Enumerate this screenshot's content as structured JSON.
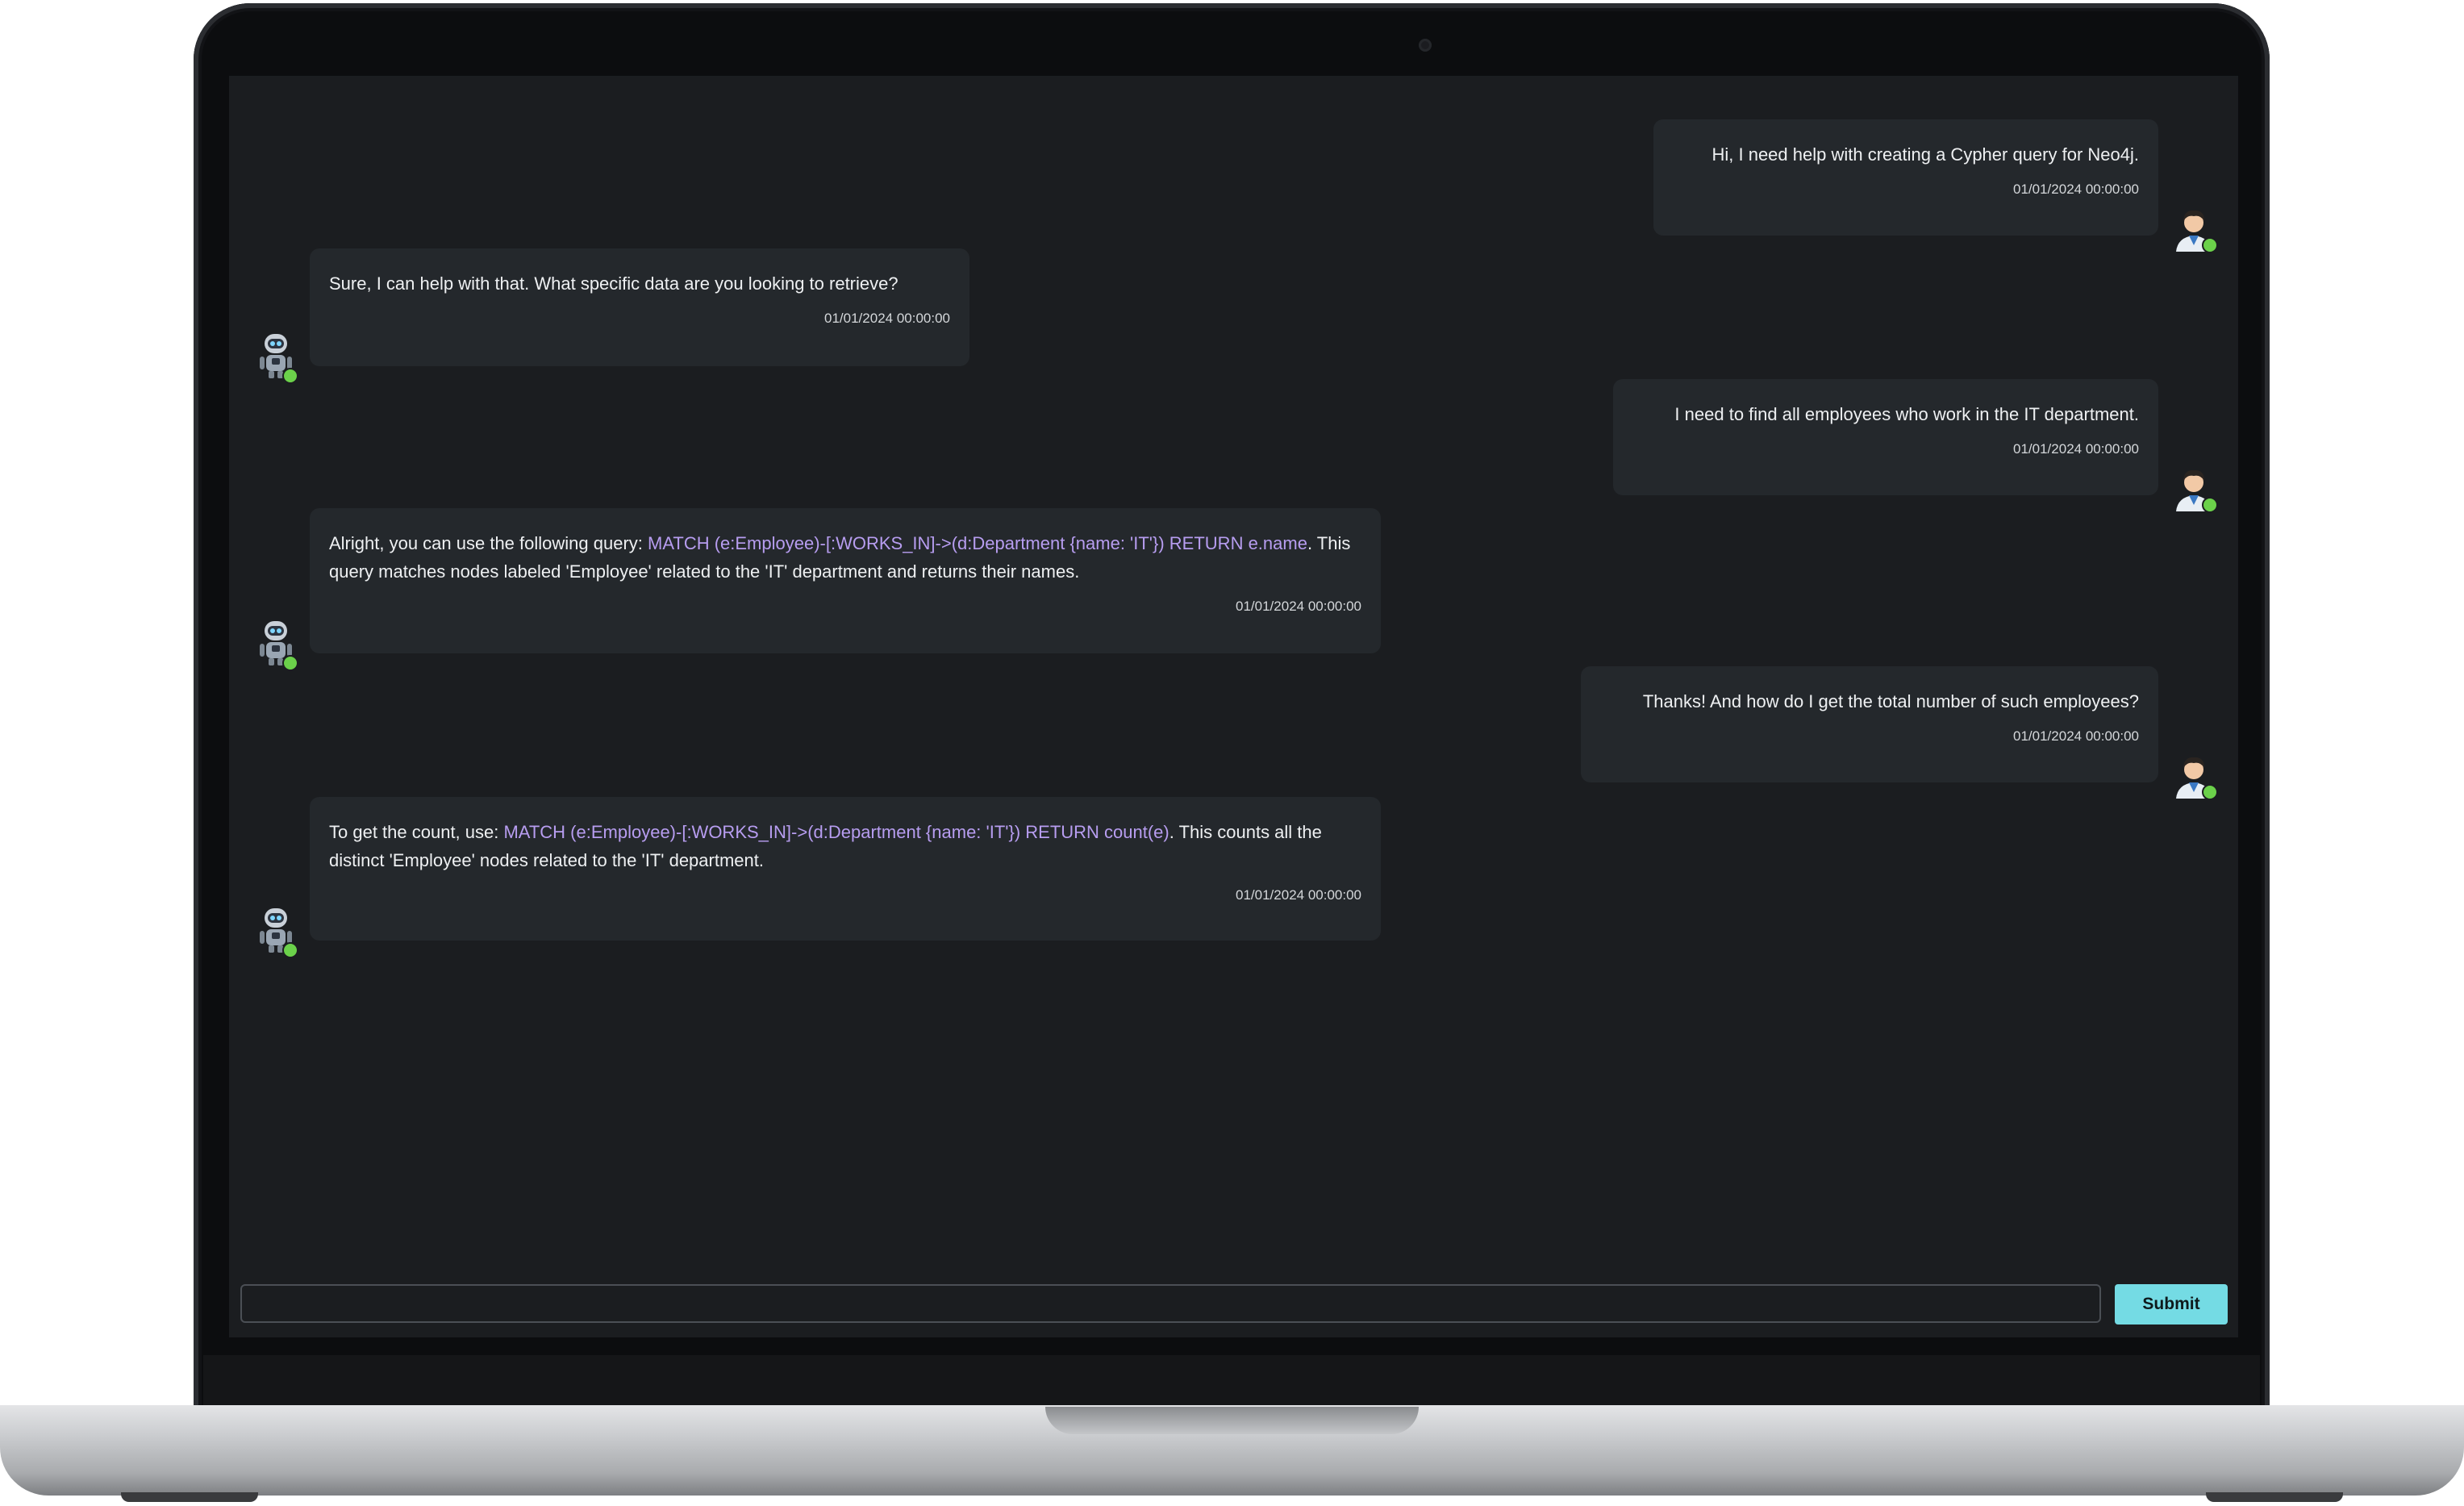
{
  "chat": {
    "messages": [
      {
        "role": "user",
        "text": "Hi, I need help with creating a Cypher query for Neo4j.",
        "time": "01/01/2024 00:00:00"
      },
      {
        "role": "bot",
        "text": "Sure, I can help with that. What specific data are you looking to retrieve?",
        "time": "01/01/2024 00:00:00"
      },
      {
        "role": "user",
        "text": "I need to find all employees who work in the IT department.",
        "time": "01/01/2024 00:00:00"
      },
      {
        "role": "bot",
        "pre": "Alright, you can use the following query: ",
        "code": "MATCH (e:Employee)-[:WORKS_IN]->(d:Department {name: 'IT'}) RETURN e.name",
        "post": ". This query matches nodes labeled 'Employee' related to the 'IT' department and returns their names.",
        "time": "01/01/2024 00:00:00"
      },
      {
        "role": "user",
        "text": "Thanks! And how do I get the total number of such employees?",
        "time": "01/01/2024 00:00:00"
      },
      {
        "role": "bot",
        "pre": "To get the count, use: ",
        "code": "MATCH (e:Employee)-[:WORKS_IN]->(d:Department {name: 'IT'}) RETURN count(e)",
        "post": ". This counts all the distinct 'Employee' nodes related to the 'IT' department.",
        "time": "01/01/2024 00:00:00"
      }
    ]
  },
  "composer": {
    "input_value": "",
    "submit_label": "Submit"
  },
  "colors": {
    "background": "#1b1d20",
    "bubble": "#24282c",
    "code": "#b79df0",
    "status_online": "#6bd14a",
    "submit": "#74dbe4"
  },
  "icons": {
    "user_avatar": "user-avatar-icon",
    "bot_avatar": "robot-avatar-icon",
    "status": "online-status-icon"
  }
}
